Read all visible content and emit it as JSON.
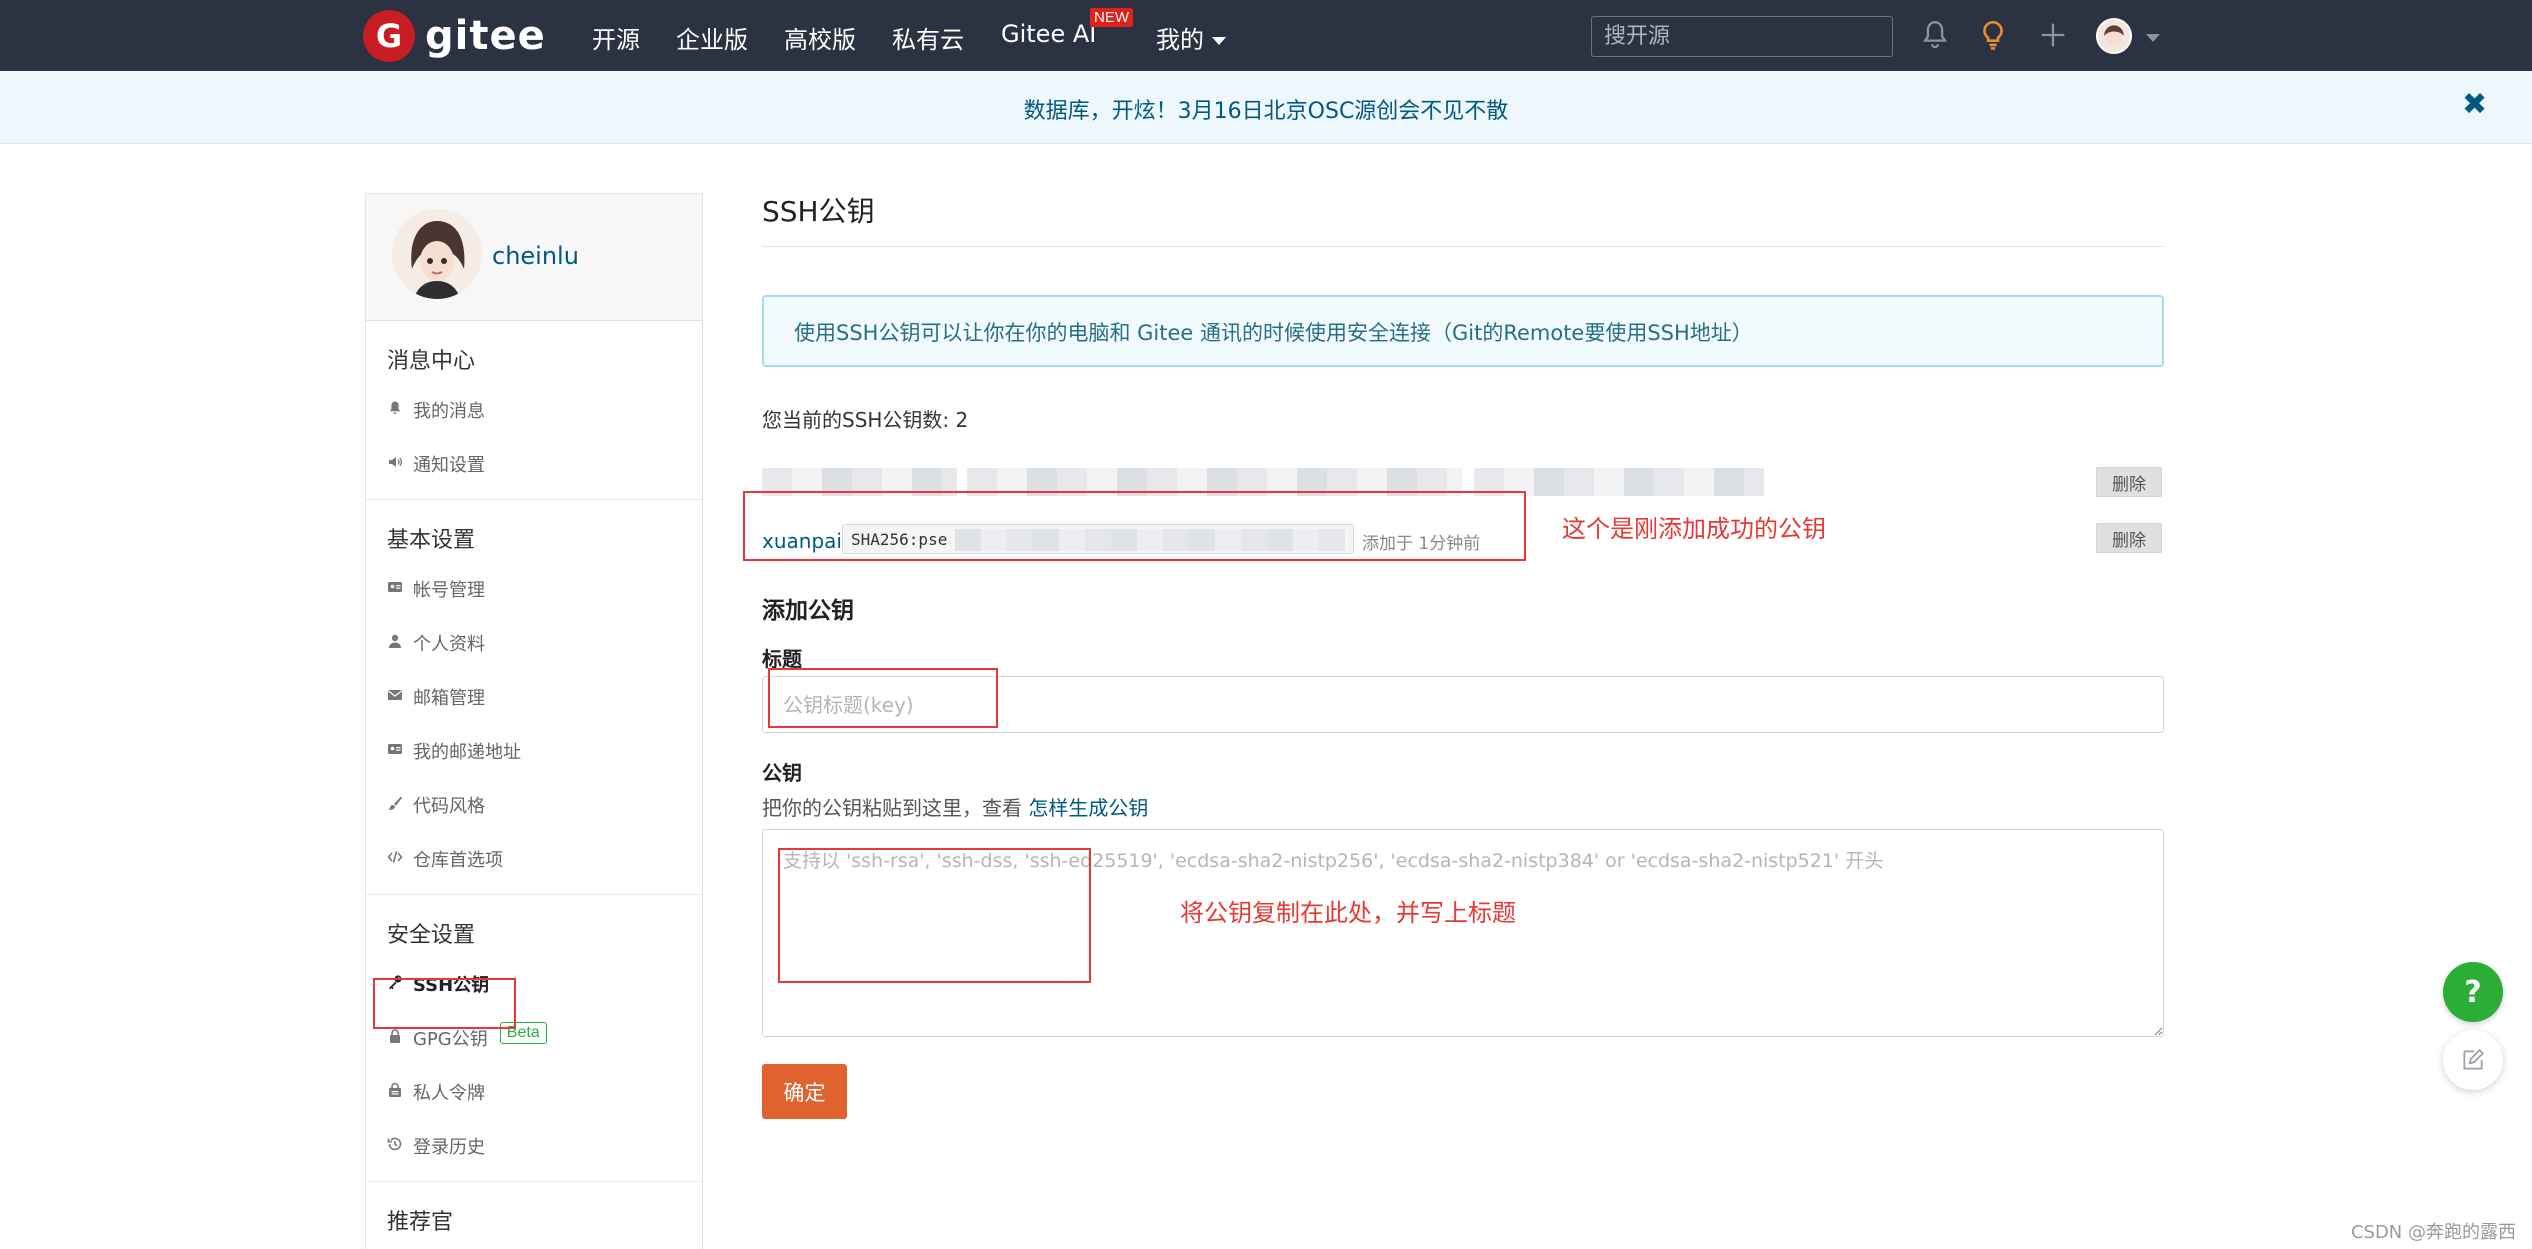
{
  "nav": {
    "logo_letter": "G",
    "logo_text": "gitee",
    "items": [
      "开源",
      "企业版",
      "高校版",
      "私有云",
      "Gitee AI",
      "我的"
    ],
    "new_badge": "NEW",
    "search_placeholder": "搜开源",
    "bell_icon": "bell-icon",
    "bulb_icon": "lightbulb-icon",
    "plus_icon": "plus-icon"
  },
  "banner": {
    "text": "数据库，开炫！3月16日北京OSC源创会不见不散",
    "close": "✖"
  },
  "sidebar": {
    "username": "cheinlu",
    "groups": [
      {
        "title": "消息中心",
        "items": [
          {
            "label": "我的消息",
            "icon": "bell-icon"
          },
          {
            "label": "通知设置",
            "icon": "speaker-icon"
          }
        ]
      },
      {
        "title": "基本设置",
        "items": [
          {
            "label": "帐号管理",
            "icon": "id-card-icon"
          },
          {
            "label": "个人资料",
            "icon": "user-icon"
          },
          {
            "label": "邮箱管理",
            "icon": "envelope-icon"
          },
          {
            "label": "我的邮递地址",
            "icon": "address-card-icon"
          },
          {
            "label": "代码风格",
            "icon": "brush-icon"
          },
          {
            "label": "仓库首选项",
            "icon": "code-icon"
          }
        ]
      },
      {
        "title": "安全设置",
        "items": [
          {
            "label": "SSH公钥",
            "icon": "key-icon",
            "active": true
          },
          {
            "label": "GPG公钥",
            "icon": "lock-icon",
            "badge": "Beta"
          },
          {
            "label": "私人令牌",
            "icon": "token-icon"
          },
          {
            "label": "登录历史",
            "icon": "history-icon"
          }
        ]
      },
      {
        "title": "推荐官",
        "items": []
      }
    ]
  },
  "main": {
    "title": "SSH公钥",
    "info": "使用SSH公钥可以让你在你的电脑和 Gitee 通讯的时候使用安全连接（Git的Remote要使用SSH地址）",
    "count_text": "您当前的SSH公钥数: 2",
    "keys": [
      {
        "name": "",
        "fingerprint": "",
        "added": "",
        "delete_label": "删除"
      },
      {
        "name": "xuanpai",
        "fingerprint": "SHA256:pse",
        "added": "添加于 1分钟前",
        "delete_label": "删除"
      }
    ],
    "add_title": "添加公钥",
    "title_label": "标题",
    "title_placeholder": "公钥标题(key)",
    "key_label": "公钥",
    "key_hint": "把你的公钥粘贴到这里，查看",
    "key_hint_link": "怎样生成公钥",
    "key_placeholder": "支持以 'ssh-rsa', 'ssh-dss, 'ssh-ed25519', 'ecdsa-sha2-nistp256', 'ecdsa-sha2-nistp384' or 'ecdsa-sha2-nistp521' 开头",
    "submit_label": "确定"
  },
  "annotations": {
    "key_note": "这个是刚添加成功的公钥",
    "paste_note": "将公钥复制在此处，并写上标题"
  },
  "floating": {
    "help": "?",
    "edit_icon": "edit-icon"
  },
  "watermark": "CSDN @奔跑的露西",
  "colors": {
    "nav_bg": "#2b3242",
    "brand_red": "#c71d23",
    "link_blue": "#005980",
    "submit_orange": "#e0632f",
    "annotation_red": "#e53935",
    "help_green": "#2bae36"
  }
}
